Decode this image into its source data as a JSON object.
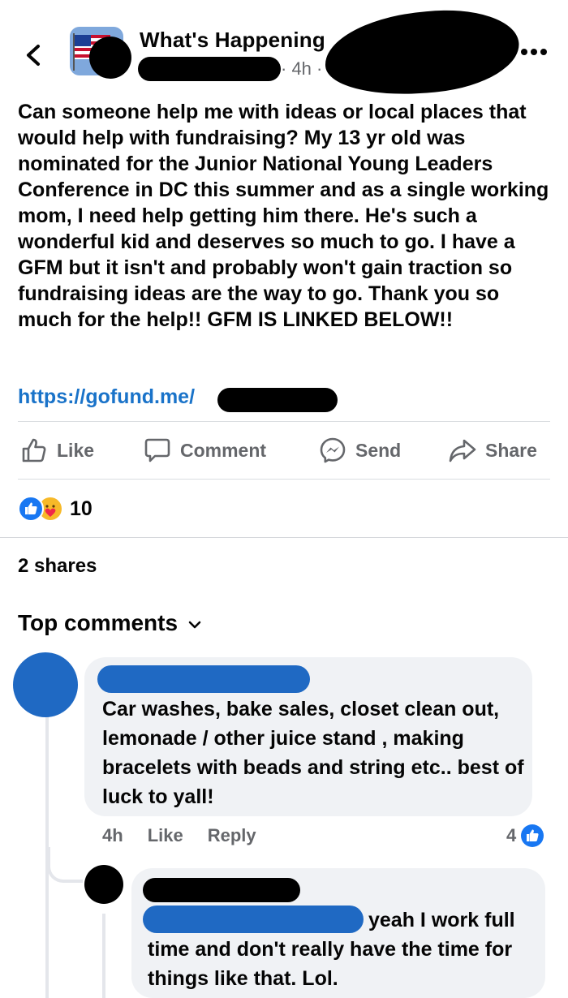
{
  "header": {
    "group_name": "What's Happening",
    "time": "· 4h ·",
    "back_icon": "chevron-left-icon",
    "more_icon": "more-dots-icon"
  },
  "post": {
    "text": "Can someone help me with ideas or local places that would help with fundraising? My 13 yr old was nominated for the Junior National Young Leaders Conference in DC this summer and as a single working mom, I need help getting him there. He's such a wonderful kid and deserves so much to go. I have a GFM but it isn't and probably won't gain traction so fundraising ideas are the way to go. Thank you so much for the help!! GFM IS LINKED BELOW!!",
    "link": "https://gofund.me/"
  },
  "actions": {
    "like": "Like",
    "comment": "Comment",
    "send": "Send",
    "share": "Share"
  },
  "reactions": {
    "count": "10"
  },
  "shares": "2 shares",
  "top_comments": "Top comments",
  "comments": [
    {
      "text": "Car washes, bake sales, closet clean out, lemonade / other juice stand , making bracelets with beads and string etc.. best of luck to yall!",
      "time": "4h",
      "like": "Like",
      "reply": "Reply",
      "likes": "4"
    },
    {
      "text_start": "yeah I work full",
      "text_rest": "time and don't really have the time for things like that. Lol."
    }
  ],
  "colors": {
    "link": "#1a73c9",
    "accent": "#1877f2",
    "muted": "#65676b",
    "bubble": "#f0f2f5",
    "redaction_blue": "#1f69c3"
  }
}
